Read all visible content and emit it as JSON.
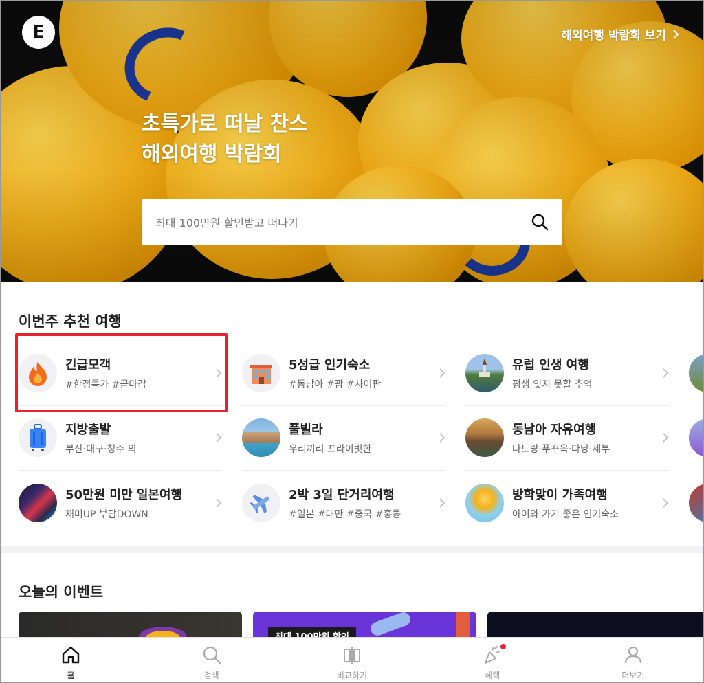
{
  "header": {
    "logo_letter": "E",
    "expo_link": "해외여행 박람회 보기"
  },
  "hero": {
    "title_line1": "초특가로 떠날 찬스",
    "title_line2": "해외여행 박람회",
    "search_placeholder": "최대 100만원 할인받고 떠나기"
  },
  "recommend": {
    "title": "이번주 추천 여행",
    "items": [
      {
        "title": "긴급모객",
        "sub": "#한정특가 #곧마감",
        "icon": "fire-icon"
      },
      {
        "title": "5성급 인기숙소",
        "sub": "#동남아 #괌 #사이판",
        "icon": "hotel-icon"
      },
      {
        "title": "유럽 인생 여행",
        "sub": "평생 잊지 못할 추억",
        "icon": "europe-photo"
      },
      {
        "title": "지방출발",
        "sub": "부산·대구·청주 외",
        "icon": "suitcase-icon"
      },
      {
        "title": "풀빌라",
        "sub": "우리끼리 프라이빗한",
        "icon": "pool-villa-photo"
      },
      {
        "title": "동남아 자유여행",
        "sub": "나트랑·푸꾸옥·다낭·세부",
        "icon": "sea-photo"
      },
      {
        "title": "50만원 미만 일본여행",
        "sub": "재미UP 부담DOWN",
        "icon": "japan-street-photo"
      },
      {
        "title": "2박 3일 단거리여행",
        "sub": "#일본 #대만 #중국 #홍콩",
        "icon": "airplane-icon"
      },
      {
        "title": "방학맞이 가족여행",
        "sub": "아이와 가기 좋은 인기숙소",
        "icon": "family-photo"
      }
    ]
  },
  "events": {
    "title": "오늘의 이벤트",
    "badge": "최대 100만원 할인"
  },
  "bottom_nav": [
    {
      "label": "홈",
      "icon": "home-icon",
      "active": true
    },
    {
      "label": "검색",
      "icon": "search-icon",
      "active": false
    },
    {
      "label": "비교하기",
      "icon": "compare-icon",
      "active": false
    },
    {
      "label": "혜택",
      "icon": "party-popper-icon",
      "active": false
    },
    {
      "label": "더보기",
      "icon": "person-icon",
      "active": false
    }
  ],
  "colors": {
    "accent_red": "#e8222f",
    "hero_yellow": "#f6b21a",
    "hero_blue": "#1c3a9e"
  }
}
